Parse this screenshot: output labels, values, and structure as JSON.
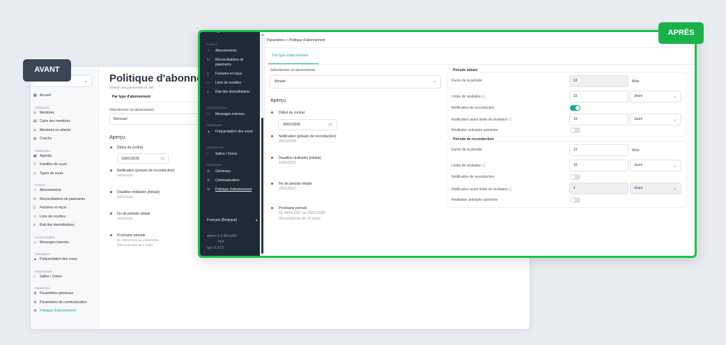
{
  "labels": {
    "before": "AVANT",
    "after": "APRÈS"
  },
  "before": {
    "sidebar_items": [
      {
        "section": "",
        "icon": "home-icon",
        "label": "Accueil"
      },
      {
        "section": "Utilisateurs",
        "icon": "users-icon",
        "label": "Membres"
      },
      {
        "section": "",
        "icon": "card-icon",
        "label": "Carte des membres"
      },
      {
        "section": "",
        "icon": "user-clock-icon",
        "label": "Membres en attente"
      },
      {
        "section": "",
        "icon": "whistle-icon",
        "label": "Coachs"
      },
      {
        "section": "Planification",
        "icon": "calendar-icon",
        "label": "Agenda"
      },
      {
        "section": "",
        "icon": "filter-icon",
        "label": "Familles de cours"
      },
      {
        "section": "",
        "icon": "tag-icon",
        "label": "Types de cours"
      },
      {
        "section": "Finance",
        "icon": "star-icon",
        "label": "Abonnements"
      },
      {
        "section": "",
        "icon": "sync-icon",
        "label": "Réconciliations de paiements"
      },
      {
        "section": "",
        "icon": "file-icon",
        "label": "Factures et reçus"
      },
      {
        "section": "",
        "icon": "book-icon",
        "label": "Livre de recettes"
      },
      {
        "section": "",
        "icon": "list-icon",
        "label": "État des domiciliations"
      },
      {
        "section": "Communication",
        "icon": "message-icon",
        "label": "Messages internes"
      },
      {
        "section": "Statistiques",
        "icon": "chart-icon",
        "label": "Fréquentation des cours"
      },
      {
        "section": "Infrastructure",
        "icon": "building-icon",
        "label": "Salles / Zones"
      },
      {
        "section": "Paramètres",
        "icon": "gear-icon",
        "label": "Paramètres généraux"
      },
      {
        "section": "",
        "icon": "gear-icon",
        "label": "Paramètres de communication"
      },
      {
        "section": "",
        "icon": "gear-icon",
        "label": "Politique d'abonnement"
      }
    ],
    "title": "Politique d'abonnement",
    "subtitle": "Gestion des paramètres du club",
    "tab": "Par type d'abonnement",
    "select_label": "Sélectionner un abonnement",
    "select_value": "Mensuel",
    "preview_title": "Aperçu",
    "start_label": "Début du contrat",
    "start_date": "19/01/2026",
    "timeline": [
      {
        "title": "Notification (préavis de reconduction)",
        "date": "05/02/2026"
      },
      {
        "title": "Deadline résiliation (initiale)",
        "date": "09/02/2026"
      },
      {
        "title": "Fin de période initiale",
        "date": "18/02/2026"
      },
      {
        "title": "Prochaine période",
        "date": "Du 19/02/2026 au 18/03/2026",
        "extra": "(Reconduction de 1 mois)"
      }
    ]
  },
  "after": {
    "sidebar": [
      {
        "section": "Finance",
        "icon": "star-icon",
        "label": "Abonnements"
      },
      {
        "section": "",
        "icon": "sync-icon",
        "label": "Réconciliations de paiements"
      },
      {
        "section": "",
        "icon": "file-icon",
        "label": "Factures et reçus"
      },
      {
        "section": "",
        "icon": "book-icon",
        "label": "Livre de recettes"
      },
      {
        "section": "",
        "icon": "list-icon",
        "label": "État des domiciliations"
      },
      {
        "section": "Communication",
        "icon": "message-icon",
        "label": "Messages internes"
      },
      {
        "section": "Statistiques",
        "icon": "chart-icon",
        "label": "Fréquentation des cours"
      },
      {
        "section": "Infrastructure",
        "icon": "building-icon",
        "label": "Salles / Zones"
      },
      {
        "section": "Paramètres",
        "icon": "gear-icon",
        "label": "Généraux"
      },
      {
        "section": "",
        "icon": "gear-icon",
        "label": "Communication"
      },
      {
        "section": "",
        "icon": "gear-icon",
        "label": "Politique d'abonnement"
      }
    ],
    "language": "Français (Belgique)",
    "user": "admin-3.9.46-ts250",
    "user2": "b64",
    "api": "api   v3.9.51",
    "breadcrumb": "Paramètres  >  Politique d'abonnement",
    "tab": "Par type d'abonnement",
    "select_label": "Sélectionner un abonnement",
    "select_value": "Annuel",
    "preview_title": "Aperçu",
    "start_label": "Début du contrat",
    "start_date": "30/01/2026",
    "timeline": [
      {
        "title": "Notification (préavis de reconduction)",
        "date": "30/12/2026"
      },
      {
        "title": "Deadline résiliation (initiale)",
        "date": "14/01/2027"
      },
      {
        "title": "Fin de période initiale",
        "date": "29/01/2027"
      },
      {
        "title": "Prochaine période",
        "date": "Du 30/01/2027 au 29/01/2028",
        "extra": "(Reconduction de 12 mois)"
      }
    ],
    "initial": {
      "title": "Période initiale",
      "duration_label": "Durée de la période",
      "duration_value": "12",
      "duration_unit": "Mois",
      "limit_label": "Limite de résiliation",
      "limit_value": "15",
      "limit_unit": "Jours",
      "notif_label": "Notification de reconduction",
      "notif_before_label": "Notification avant limite de résiliation",
      "notif_before_value": "15",
      "notif_before_unit": "Jours",
      "early_label": "Résiliation anticipée autorisée"
    },
    "renewal": {
      "title": "Période de reconduction",
      "duration_label": "Durée de la période",
      "duration_value": "12",
      "duration_unit": "Mois",
      "limit_label": "Limite de résiliation",
      "limit_value": "15",
      "limit_unit": "Jours",
      "notif_label": "Notification de reconduction",
      "notif_before_label": "Notification avant limite de résiliation",
      "notif_before_value": "1",
      "notif_before_unit": "Jours",
      "early_label": "Résiliation anticipée autorisée"
    },
    "colors": {
      "accent": "#14a7a0",
      "frame": "#19c24c",
      "sidebar": "#1f2a36"
    }
  }
}
